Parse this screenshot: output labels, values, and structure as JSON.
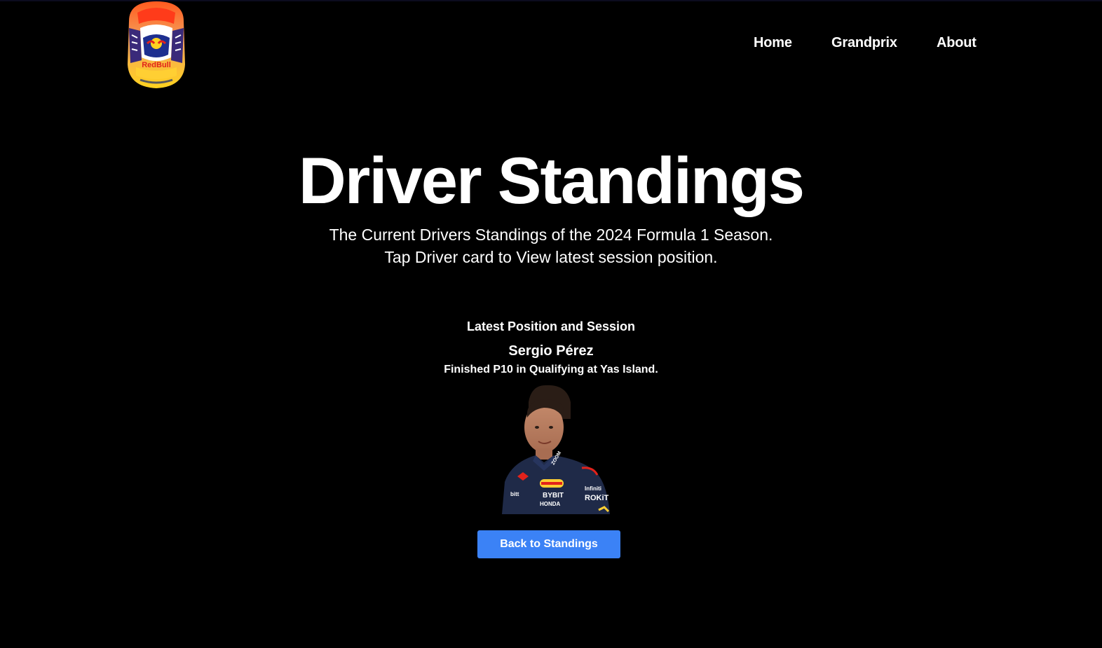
{
  "nav": {
    "home_label": "Home",
    "grandprix_label": "Grandprix",
    "about_label": "About"
  },
  "logo": {
    "icon": "red-bull-helmet-icon",
    "brand_text": "RedBull"
  },
  "hero": {
    "title": "Driver Standings",
    "subtitle_line1": "The Current Drivers Standings of the 2024 Formula 1 Season.",
    "subtitle_line2": "Tap Driver card to View latest session position."
  },
  "latest": {
    "heading": "Latest Position and Session",
    "driver_name": "Sergio Pérez",
    "result_text": "Finished P10 in Qualifying at Yas Island.",
    "portrait_icon": "driver-portrait",
    "suit_text": [
      "BYBIT",
      "HONDA",
      "ROKiT",
      "Infiniti",
      "ZOOM",
      "bitt"
    ]
  },
  "actions": {
    "back_label": "Back to Standings"
  },
  "colors": {
    "background": "#000000",
    "text": "#ffffff",
    "button": "#3b82f6"
  }
}
